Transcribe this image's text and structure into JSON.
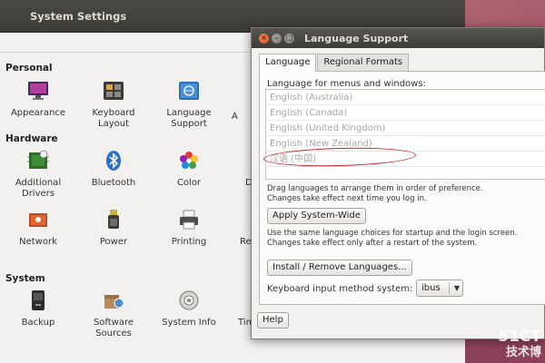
{
  "system_settings": {
    "title": "System Settings",
    "sections": [
      {
        "title": "Personal",
        "items": [
          {
            "label": "Appearance",
            "icon": "appearance-icon"
          },
          {
            "label": "Keyboard\nLayout",
            "icon": "keyboard-layout-icon"
          },
          {
            "label": "Language\nSupport",
            "icon": "language-support-icon"
          },
          {
            "label": "A",
            "icon": "partial-icon"
          }
        ]
      },
      {
        "title": "Hardware",
        "items": [
          {
            "label": "Additional\nDrivers",
            "icon": "additional-drivers-icon"
          },
          {
            "label": "Bluetooth",
            "icon": "bluetooth-icon"
          },
          {
            "label": "Color",
            "icon": "color-icon"
          },
          {
            "label": "D",
            "icon": "partial-icon"
          },
          {
            "label": "Network",
            "icon": "network-icon"
          },
          {
            "label": "Power",
            "icon": "power-icon"
          },
          {
            "label": "Printing",
            "icon": "printing-icon"
          },
          {
            "label": "Re",
            "icon": "partial-icon"
          }
        ]
      },
      {
        "title": "System",
        "items": [
          {
            "label": "Backup",
            "icon": "backup-icon"
          },
          {
            "label": "Software\nSources",
            "icon": "software-sources-icon"
          },
          {
            "label": "System Info",
            "icon": "system-info-icon"
          },
          {
            "label": "Tim",
            "icon": "partial-icon"
          }
        ]
      }
    ]
  },
  "dialog": {
    "title": "Language Support",
    "tabs": [
      "Language",
      "Regional Formats"
    ],
    "active_tab": "Language",
    "language_list_label": "Language for menus and windows:",
    "languages": [
      "English (Australia)",
      "English (Canada)",
      "English (United Kingdom)",
      "English (New Zealand)",
      "汉语 (中国)"
    ],
    "drag_hint_1": "Drag languages to arrange them in order of preference.",
    "drag_hint_2": "Changes take effect next time you log in.",
    "apply_button": "Apply System-Wide",
    "apply_hint_1": "Use the same language choices for startup and the login screen.",
    "apply_hint_2": "Changes take effect only after a restart of the system.",
    "install_button": "Install / Remove Languages...",
    "keyboard_label": "Keyboard input method system:",
    "keyboard_value": "ibus",
    "help_button": "Help"
  },
  "watermark": {
    "line1": "51CT",
    "line2": "技术博"
  },
  "colors": {
    "accent_close": "#dd4814",
    "annotation_red": "#c8242a",
    "titlebar": "#3c3b37"
  }
}
